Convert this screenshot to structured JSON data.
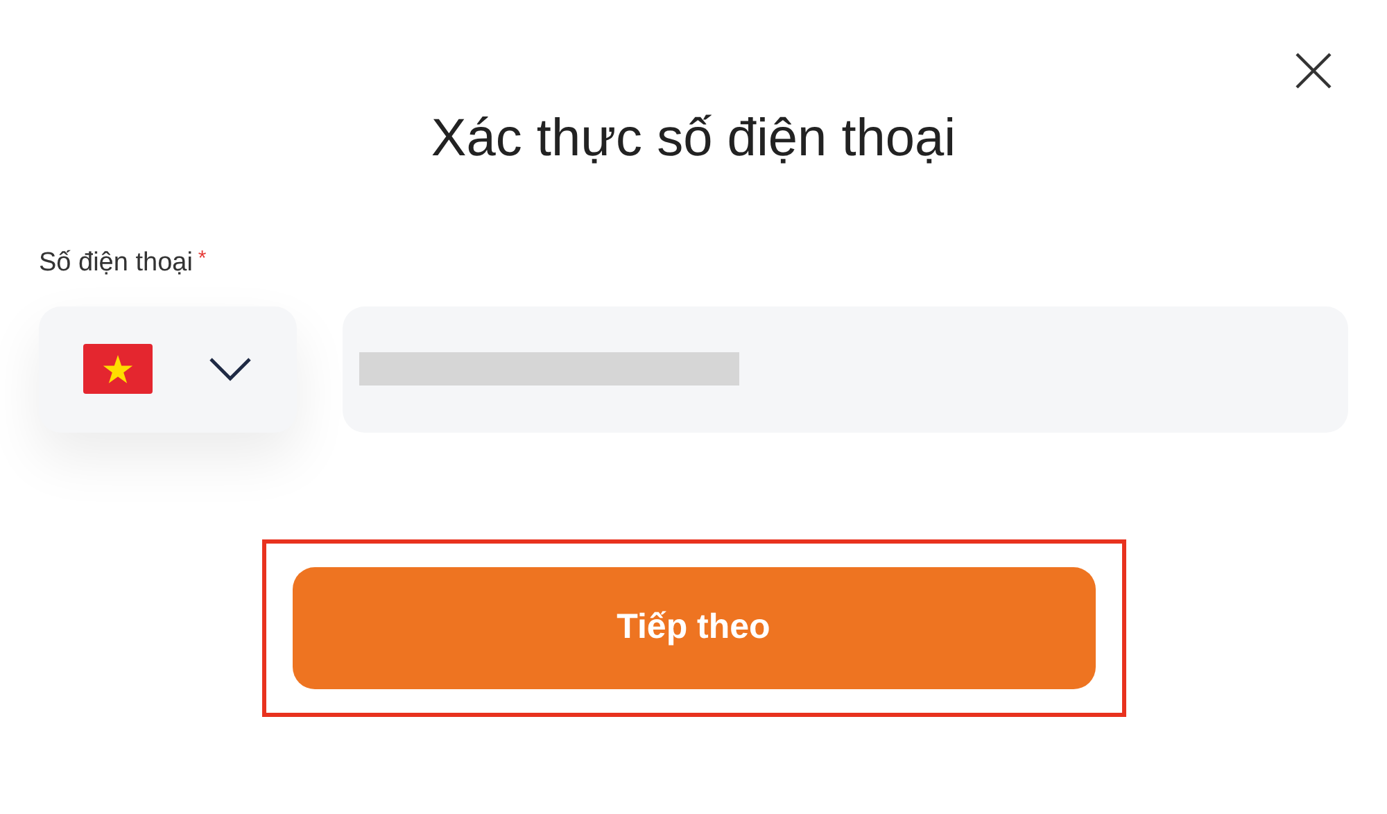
{
  "dialog": {
    "title": "Xác thực số điện thoại"
  },
  "phone_field": {
    "label": "Số điện thoại",
    "required_mark": "*"
  },
  "next_button": {
    "label": "Tiếp theo",
    "highlighted": true
  }
}
